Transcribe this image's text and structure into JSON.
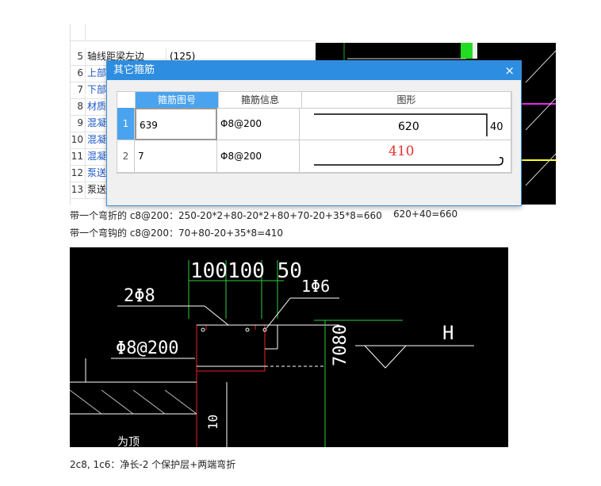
{
  "prop_panel": {
    "rows": [
      {
        "num": "",
        "label": "",
        "value": ""
      },
      {
        "num": "5",
        "label": "轴线距梁左边",
        "value": "(125)"
      },
      {
        "num": "6",
        "label": "上部",
        "value": ""
      },
      {
        "num": "7",
        "label": "下部",
        "value": ""
      },
      {
        "num": "8",
        "label": "材质",
        "value": ""
      },
      {
        "num": "9",
        "label": "混凝",
        "value": ""
      },
      {
        "num": "10",
        "label": "混凝",
        "value": ""
      },
      {
        "num": "11",
        "label": "混凝",
        "value": ""
      },
      {
        "num": "12",
        "label": "泵送",
        "value": ""
      },
      {
        "num": "13",
        "label": "泵送",
        "value": ""
      }
    ]
  },
  "dialog": {
    "title": "其它箍筋",
    "close": "×",
    "headers": {
      "code": "箍筋图号",
      "info": "箍筋信息",
      "shape": "图形"
    },
    "rows": [
      {
        "idx": "1",
        "code": "639",
        "info": "Φ8@200",
        "dim_main": "620",
        "dim_side": "40"
      },
      {
        "idx": "2",
        "code": "7",
        "info": "Φ8@200",
        "dim_main": "410"
      }
    ]
  },
  "notes": {
    "line1": "带一个弯折的 c8@200：250-20*2+80-20*2+80+70-20+35*8=660",
    "line1b": "620+40=660",
    "line2": "带一个弯钩的 c8@200：70+80-20+35*8=410",
    "footer": "2c8,    1c6：净长-2 个保护层+两端弯折"
  },
  "cad": {
    "dims_top": "100100 50",
    "label_2phi8": "2Φ8",
    "label_1phi6": "1Φ6",
    "label_phi8_200": "Φ8@200",
    "label_7080": "7080",
    "label_h": "H",
    "label_10": "10",
    "label_bottom": "为顶"
  }
}
